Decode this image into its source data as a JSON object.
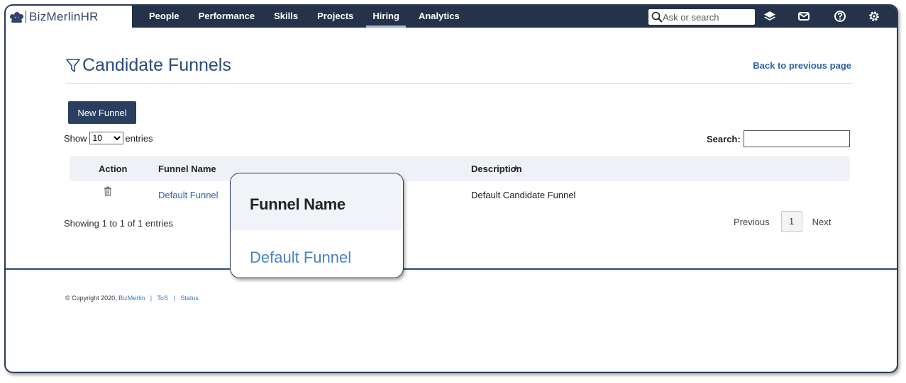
{
  "nav": {
    "logo_text": "BizMerlinHR",
    "menu": [
      {
        "label": "People",
        "active": false
      },
      {
        "label": "Performance",
        "active": false
      },
      {
        "label": "Skills",
        "active": false
      },
      {
        "label": "Projects",
        "active": false
      },
      {
        "label": "Hiring",
        "active": true
      },
      {
        "label": "Analytics",
        "active": false
      }
    ],
    "search_placeholder": "Ask or search",
    "icons": [
      "layers-icon",
      "mail-icon",
      "help-icon",
      "settings-icon"
    ]
  },
  "page": {
    "title": "Candidate Funnels",
    "back_link": "Back to previous page",
    "new_button": "New Funnel"
  },
  "table_controls": {
    "show_label": "Show",
    "entries_label": "entries",
    "page_length": "10",
    "search_label": "Search:"
  },
  "table": {
    "headers": {
      "action": "Action",
      "name": "Funnel Name",
      "description": "Description"
    },
    "rows": [
      {
        "name": "Default Funnel",
        "description": "Default Candidate Funnel"
      }
    ],
    "info": "Showing 1 to 1 of 1 entries",
    "pager": {
      "previous": "Previous",
      "current": "1",
      "next": "Next"
    }
  },
  "footer": {
    "copyright": "© Copyright 2020,",
    "company": "BizMerlin",
    "tos": "ToS",
    "status": "Status",
    "separator": "|"
  },
  "callout": {
    "header": "Funnel Name",
    "value": "Default Funnel"
  },
  "colors": {
    "nav_bg": "#24324a",
    "primary_button": "#2a3f60",
    "link": "#2e62a8",
    "title": "#2b4c78"
  }
}
